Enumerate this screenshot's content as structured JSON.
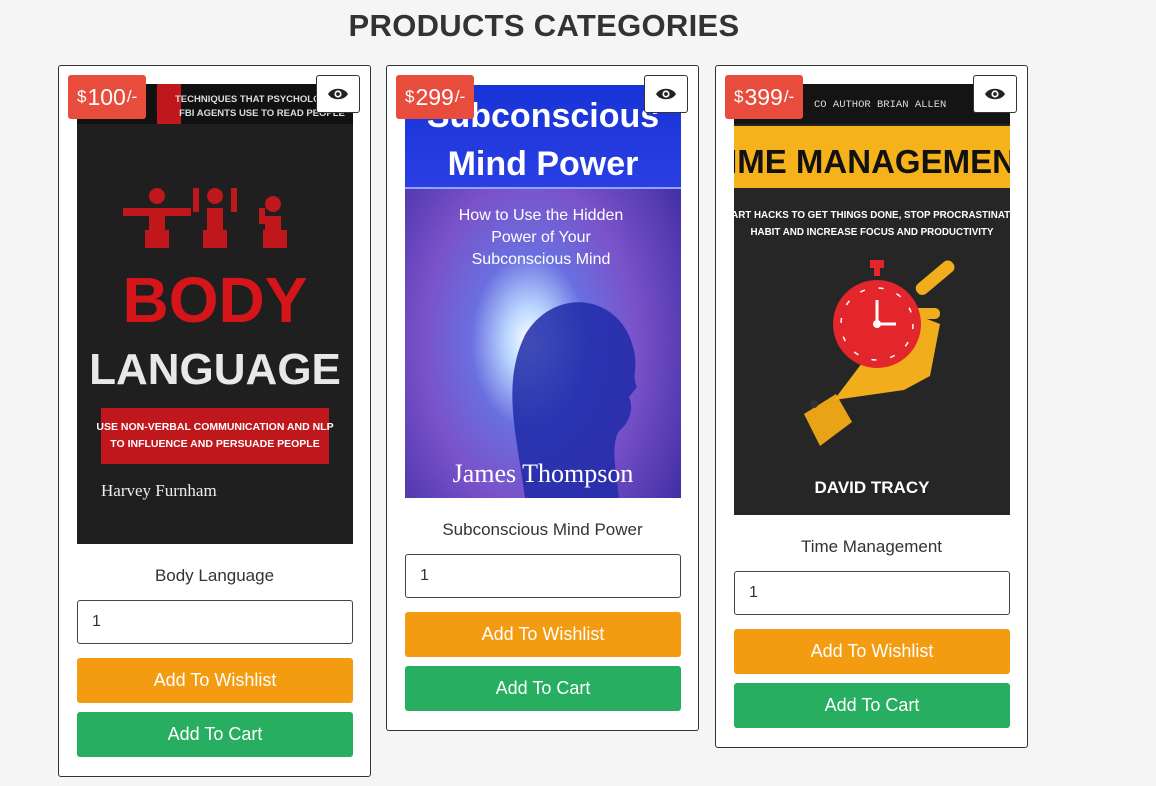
{
  "page": {
    "title": "PRODUCTS CATEGORIES"
  },
  "colors": {
    "price_badge": "#e74c3c",
    "wishlist": "#f39c12",
    "cart": "#27ae60"
  },
  "products": [
    {
      "name": "Body Language",
      "price": {
        "currency": "$",
        "amount": "100",
        "suffix": "/-"
      },
      "quantity": "1",
      "wishlist_label": "Add To Wishlist",
      "cart_label": "Add To Cart",
      "view_icon": "eye-icon",
      "cover": {
        "banner_line1": "TECHNIQUES THAT PSYCHOLOGISTS",
        "banner_line2": "FBI AGENTS USE TO READ PEOPLE",
        "title_line1": "BODY",
        "title_line2": "LANGUAGE",
        "subtitle_line1": "USE NON-VERBAL COMMUNICATION AND NLP",
        "subtitle_line2": "TO INFLUENCE AND PERSUADE PEOPLE",
        "author": "Harvey Furnham"
      }
    },
    {
      "name": "Subconscious Mind Power",
      "price": {
        "currency": "$",
        "amount": "299",
        "suffix": "/-"
      },
      "quantity": "1",
      "wishlist_label": "Add To Wishlist",
      "cart_label": "Add To Cart",
      "view_icon": "eye-icon",
      "cover": {
        "title_line1": "Subconscious",
        "title_line2": "Mind Power",
        "subtitle_line1": "How to Use the Hidden",
        "subtitle_line2": "Power of Your",
        "subtitle_line3": "Subconscious Mind",
        "author": "James Thompson"
      }
    },
    {
      "name": "Time Management",
      "price": {
        "currency": "$",
        "amount": "399",
        "suffix": "/-"
      },
      "quantity": "1",
      "wishlist_label": "Add To Wishlist",
      "cart_label": "Add To Cart",
      "view_icon": "eye-icon",
      "cover": {
        "banner": "CO AUTHOR BRIAN ALLEN",
        "title": "TIME MANAGEMENT",
        "subtitle_line1": "SMART HACKS TO GET THINGS DONE, STOP PROCRASTINATION",
        "subtitle_line2": "HABIT AND INCREASE FOCUS AND PRODUCTIVITY",
        "author": "DAVID TRACY"
      }
    }
  ]
}
